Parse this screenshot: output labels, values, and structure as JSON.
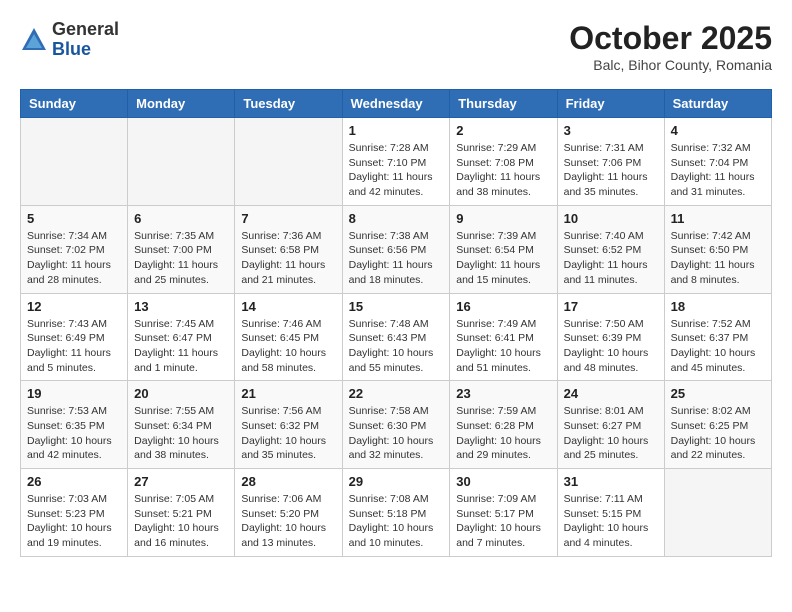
{
  "header": {
    "logo_general": "General",
    "logo_blue": "Blue",
    "month_title": "October 2025",
    "subtitle": "Balc, Bihor County, Romania"
  },
  "calendar": {
    "weekdays": [
      "Sunday",
      "Monday",
      "Tuesday",
      "Wednesday",
      "Thursday",
      "Friday",
      "Saturday"
    ],
    "weeks": [
      [
        {
          "day": "",
          "sunrise": "",
          "sunset": "",
          "daylight": ""
        },
        {
          "day": "",
          "sunrise": "",
          "sunset": "",
          "daylight": ""
        },
        {
          "day": "",
          "sunrise": "",
          "sunset": "",
          "daylight": ""
        },
        {
          "day": "1",
          "sunrise": "Sunrise: 7:28 AM",
          "sunset": "Sunset: 7:10 PM",
          "daylight": "Daylight: 11 hours and 42 minutes."
        },
        {
          "day": "2",
          "sunrise": "Sunrise: 7:29 AM",
          "sunset": "Sunset: 7:08 PM",
          "daylight": "Daylight: 11 hours and 38 minutes."
        },
        {
          "day": "3",
          "sunrise": "Sunrise: 7:31 AM",
          "sunset": "Sunset: 7:06 PM",
          "daylight": "Daylight: 11 hours and 35 minutes."
        },
        {
          "day": "4",
          "sunrise": "Sunrise: 7:32 AM",
          "sunset": "Sunset: 7:04 PM",
          "daylight": "Daylight: 11 hours and 31 minutes."
        }
      ],
      [
        {
          "day": "5",
          "sunrise": "Sunrise: 7:34 AM",
          "sunset": "Sunset: 7:02 PM",
          "daylight": "Daylight: 11 hours and 28 minutes."
        },
        {
          "day": "6",
          "sunrise": "Sunrise: 7:35 AM",
          "sunset": "Sunset: 7:00 PM",
          "daylight": "Daylight: 11 hours and 25 minutes."
        },
        {
          "day": "7",
          "sunrise": "Sunrise: 7:36 AM",
          "sunset": "Sunset: 6:58 PM",
          "daylight": "Daylight: 11 hours and 21 minutes."
        },
        {
          "day": "8",
          "sunrise": "Sunrise: 7:38 AM",
          "sunset": "Sunset: 6:56 PM",
          "daylight": "Daylight: 11 hours and 18 minutes."
        },
        {
          "day": "9",
          "sunrise": "Sunrise: 7:39 AM",
          "sunset": "Sunset: 6:54 PM",
          "daylight": "Daylight: 11 hours and 15 minutes."
        },
        {
          "day": "10",
          "sunrise": "Sunrise: 7:40 AM",
          "sunset": "Sunset: 6:52 PM",
          "daylight": "Daylight: 11 hours and 11 minutes."
        },
        {
          "day": "11",
          "sunrise": "Sunrise: 7:42 AM",
          "sunset": "Sunset: 6:50 PM",
          "daylight": "Daylight: 11 hours and 8 minutes."
        }
      ],
      [
        {
          "day": "12",
          "sunrise": "Sunrise: 7:43 AM",
          "sunset": "Sunset: 6:49 PM",
          "daylight": "Daylight: 11 hours and 5 minutes."
        },
        {
          "day": "13",
          "sunrise": "Sunrise: 7:45 AM",
          "sunset": "Sunset: 6:47 PM",
          "daylight": "Daylight: 11 hours and 1 minute."
        },
        {
          "day": "14",
          "sunrise": "Sunrise: 7:46 AM",
          "sunset": "Sunset: 6:45 PM",
          "daylight": "Daylight: 10 hours and 58 minutes."
        },
        {
          "day": "15",
          "sunrise": "Sunrise: 7:48 AM",
          "sunset": "Sunset: 6:43 PM",
          "daylight": "Daylight: 10 hours and 55 minutes."
        },
        {
          "day": "16",
          "sunrise": "Sunrise: 7:49 AM",
          "sunset": "Sunset: 6:41 PM",
          "daylight": "Daylight: 10 hours and 51 minutes."
        },
        {
          "day": "17",
          "sunrise": "Sunrise: 7:50 AM",
          "sunset": "Sunset: 6:39 PM",
          "daylight": "Daylight: 10 hours and 48 minutes."
        },
        {
          "day": "18",
          "sunrise": "Sunrise: 7:52 AM",
          "sunset": "Sunset: 6:37 PM",
          "daylight": "Daylight: 10 hours and 45 minutes."
        }
      ],
      [
        {
          "day": "19",
          "sunrise": "Sunrise: 7:53 AM",
          "sunset": "Sunset: 6:35 PM",
          "daylight": "Daylight: 10 hours and 42 minutes."
        },
        {
          "day": "20",
          "sunrise": "Sunrise: 7:55 AM",
          "sunset": "Sunset: 6:34 PM",
          "daylight": "Daylight: 10 hours and 38 minutes."
        },
        {
          "day": "21",
          "sunrise": "Sunrise: 7:56 AM",
          "sunset": "Sunset: 6:32 PM",
          "daylight": "Daylight: 10 hours and 35 minutes."
        },
        {
          "day": "22",
          "sunrise": "Sunrise: 7:58 AM",
          "sunset": "Sunset: 6:30 PM",
          "daylight": "Daylight: 10 hours and 32 minutes."
        },
        {
          "day": "23",
          "sunrise": "Sunrise: 7:59 AM",
          "sunset": "Sunset: 6:28 PM",
          "daylight": "Daylight: 10 hours and 29 minutes."
        },
        {
          "day": "24",
          "sunrise": "Sunrise: 8:01 AM",
          "sunset": "Sunset: 6:27 PM",
          "daylight": "Daylight: 10 hours and 25 minutes."
        },
        {
          "day": "25",
          "sunrise": "Sunrise: 8:02 AM",
          "sunset": "Sunset: 6:25 PM",
          "daylight": "Daylight: 10 hours and 22 minutes."
        }
      ],
      [
        {
          "day": "26",
          "sunrise": "Sunrise: 7:03 AM",
          "sunset": "Sunset: 5:23 PM",
          "daylight": "Daylight: 10 hours and 19 minutes."
        },
        {
          "day": "27",
          "sunrise": "Sunrise: 7:05 AM",
          "sunset": "Sunset: 5:21 PM",
          "daylight": "Daylight: 10 hours and 16 minutes."
        },
        {
          "day": "28",
          "sunrise": "Sunrise: 7:06 AM",
          "sunset": "Sunset: 5:20 PM",
          "daylight": "Daylight: 10 hours and 13 minutes."
        },
        {
          "day": "29",
          "sunrise": "Sunrise: 7:08 AM",
          "sunset": "Sunset: 5:18 PM",
          "daylight": "Daylight: 10 hours and 10 minutes."
        },
        {
          "day": "30",
          "sunrise": "Sunrise: 7:09 AM",
          "sunset": "Sunset: 5:17 PM",
          "daylight": "Daylight: 10 hours and 7 minutes."
        },
        {
          "day": "31",
          "sunrise": "Sunrise: 7:11 AM",
          "sunset": "Sunset: 5:15 PM",
          "daylight": "Daylight: 10 hours and 4 minutes."
        },
        {
          "day": "",
          "sunrise": "",
          "sunset": "",
          "daylight": ""
        }
      ]
    ]
  }
}
